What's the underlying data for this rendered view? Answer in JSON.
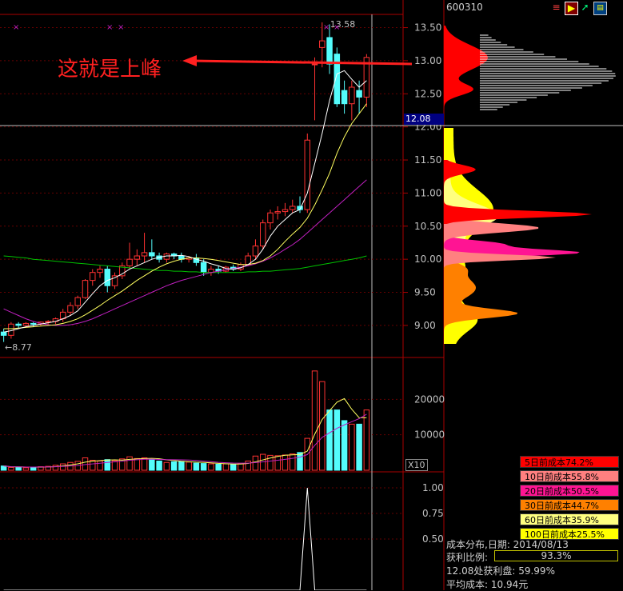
{
  "toolbar": {
    "symbol": "600310",
    "icons": [
      "bars-icon",
      "flag-icon",
      "arrow-icon",
      "window-icon"
    ]
  },
  "annotation": {
    "text": "这就是上峰"
  },
  "price_axis": {
    "labels": [
      "13.50",
      "13.00",
      "12.50",
      "12.00",
      "11.50",
      "11.00",
      "10.50",
      "10.00",
      "9.50",
      "9.00"
    ],
    "current_price": "12.08"
  },
  "candles": {
    "high_label": "13.58",
    "low_label": "8.77"
  },
  "volume_axis": {
    "labels": [
      "20000",
      "10000"
    ],
    "multiplier": "X10"
  },
  "indicator_axis": {
    "labels": [
      "1.00",
      "0.75",
      "0.50"
    ]
  },
  "chip_legend": [
    {
      "label": "5日前成本74.2%",
      "color": "#ff0000"
    },
    {
      "label": "10日前成本55.8%",
      "color": "#ff8080"
    },
    {
      "label": "20日前成本50.5%",
      "color": "#ff1493"
    },
    {
      "label": "30日前成本44.7%",
      "color": "#ff8000"
    },
    {
      "label": "60日前成本35.9%",
      "color": "#ffff80"
    },
    {
      "label": "100日前成本25.5%",
      "color": "#ffff00"
    }
  ],
  "chip_info": {
    "date_line": "成本分布,日期: 2014/08/13",
    "profit_label": "获利比例:",
    "profit_value": "93.3%",
    "profit_ratio": 0.933,
    "profit_at_price": "12.08处获利盘: 59.99%",
    "avg_cost": "平均成本: 10.94元"
  },
  "chart_data": {
    "type": "candlestick",
    "price_range": [
      8.6,
      13.7
    ],
    "candles": [
      [
        8.9,
        8.95,
        8.75,
        8.85
      ],
      [
        8.85,
        9.05,
        8.8,
        9.02
      ],
      [
        9.02,
        9.05,
        8.95,
        9.0
      ],
      [
        9.0,
        9.05,
        8.97,
        9.03
      ],
      [
        9.03,
        9.05,
        8.98,
        9.02
      ],
      [
        9.02,
        9.06,
        9.0,
        9.05
      ],
      [
        9.05,
        9.08,
        9.0,
        9.06
      ],
      [
        9.06,
        9.12,
        9.02,
        9.1
      ],
      [
        9.1,
        9.25,
        9.05,
        9.2
      ],
      [
        9.2,
        9.35,
        9.15,
        9.3
      ],
      [
        9.3,
        9.45,
        9.25,
        9.42
      ],
      [
        9.42,
        9.7,
        9.4,
        9.68
      ],
      [
        9.68,
        9.85,
        9.6,
        9.8
      ],
      [
        9.8,
        9.9,
        9.72,
        9.85
      ],
      [
        9.85,
        9.9,
        9.5,
        9.6
      ],
      [
        9.6,
        9.8,
        9.55,
        9.75
      ],
      [
        9.75,
        9.95,
        9.7,
        9.9
      ],
      [
        9.9,
        10.25,
        9.85,
        10.0
      ],
      [
        10.0,
        10.15,
        9.9,
        10.05
      ],
      [
        10.05,
        10.4,
        9.95,
        10.1
      ],
      [
        10.1,
        10.3,
        10.0,
        10.05
      ],
      [
        10.05,
        10.1,
        9.95,
        10.0
      ],
      [
        10.0,
        10.1,
        9.95,
        10.08
      ],
      [
        10.08,
        10.1,
        10.0,
        10.05
      ],
      [
        10.05,
        10.1,
        9.95,
        10.0
      ],
      [
        10.0,
        10.05,
        9.95,
        10.02
      ],
      [
        10.02,
        10.08,
        9.9,
        9.95
      ],
      [
        9.95,
        10.0,
        9.75,
        9.8
      ],
      [
        9.8,
        9.9,
        9.75,
        9.85
      ],
      [
        9.85,
        9.9,
        9.78,
        9.82
      ],
      [
        9.82,
        9.9,
        9.8,
        9.88
      ],
      [
        9.88,
        9.92,
        9.82,
        9.85
      ],
      [
        9.85,
        9.95,
        9.82,
        9.92
      ],
      [
        9.92,
        10.1,
        9.9,
        10.05
      ],
      [
        10.05,
        10.3,
        10.0,
        10.2
      ],
      [
        10.2,
        10.6,
        10.15,
        10.55
      ],
      [
        10.55,
        10.75,
        10.45,
        10.7
      ],
      [
        10.7,
        10.8,
        10.6,
        10.72
      ],
      [
        10.72,
        10.85,
        10.65,
        10.75
      ],
      [
        10.75,
        10.9,
        10.7,
        10.8
      ],
      [
        10.8,
        10.95,
        10.7,
        10.75
      ],
      [
        10.75,
        11.9,
        10.7,
        11.8
      ],
      [
        12.95,
        13.05,
        12.1,
        12.95
      ],
      [
        13.2,
        13.58,
        12.9,
        13.3
      ],
      [
        13.35,
        13.55,
        12.8,
        12.95
      ],
      [
        13.1,
        13.2,
        12.3,
        12.35
      ],
      [
        12.55,
        12.7,
        12.2,
        12.35
      ],
      [
        12.35,
        12.7,
        12.1,
        12.6
      ],
      [
        12.55,
        12.7,
        12.2,
        12.45
      ],
      [
        12.45,
        13.1,
        12.3,
        13.05
      ]
    ],
    "volumes": [
      1200,
      800,
      900,
      700,
      900,
      1000,
      1100,
      1400,
      1800,
      2200,
      2500,
      3500,
      2800,
      2600,
      3000,
      2700,
      3200,
      3800,
      3300,
      3500,
      3000,
      2600,
      2200,
      2400,
      2500,
      2300,
      2000,
      1900,
      1800,
      1700,
      1800,
      1600,
      1900,
      2600,
      4000,
      4500,
      4200,
      4100,
      4300,
      4600,
      5000,
      9000,
      28000,
      25000,
      17000,
      17000,
      14000,
      13000,
      13000,
      17000
    ],
    "volume_range": [
      0,
      30000
    ],
    "ma5": [
      8.9,
      8.92,
      8.95,
      8.98,
      9.0,
      9.02,
      9.04,
      9.06,
      9.1,
      9.15,
      9.22,
      9.35,
      9.48,
      9.6,
      9.68,
      9.72,
      9.78,
      9.85,
      9.9,
      9.95,
      10.0,
      10.03,
      10.05,
      10.05,
      10.06,
      10.04,
      10.0,
      9.97,
      9.93,
      9.9,
      9.86,
      9.85,
      9.87,
      9.92,
      10.0,
      10.15,
      10.35,
      10.5,
      10.6,
      10.7,
      10.75,
      11.0,
      11.45,
      11.9,
      12.4,
      12.8,
      12.85,
      12.72,
      12.6,
      12.7
    ],
    "ma10": [
      8.95,
      8.95,
      8.96,
      8.97,
      8.98,
      8.99,
      9.0,
      9.01,
      9.03,
      9.06,
      9.1,
      9.16,
      9.23,
      9.3,
      9.38,
      9.45,
      9.52,
      9.6,
      9.68,
      9.75,
      9.82,
      9.88,
      9.93,
      9.97,
      10.0,
      10.02,
      10.02,
      10.01,
      10.0,
      9.98,
      9.96,
      9.94,
      9.92,
      9.92,
      9.94,
      9.98,
      10.05,
      10.15,
      10.27,
      10.38,
      10.48,
      10.62,
      10.82,
      11.05,
      11.3,
      11.6,
      11.85,
      12.05,
      12.2,
      12.35
    ],
    "ma30": [
      9.25,
      9.2,
      9.15,
      9.1,
      9.06,
      9.03,
      9.01,
      9.0,
      9.0,
      9.01,
      9.03,
      9.06,
      9.1,
      9.15,
      9.2,
      9.25,
      9.3,
      9.35,
      9.4,
      9.45,
      9.5,
      9.55,
      9.6,
      9.64,
      9.68,
      9.71,
      9.74,
      9.77,
      9.8,
      9.82,
      9.84,
      9.86,
      9.88,
      9.9,
      9.93,
      9.97,
      10.02,
      10.08,
      10.15,
      10.22,
      10.3,
      10.4,
      10.5,
      10.6,
      10.7,
      10.8,
      10.9,
      11.0,
      11.1,
      11.2
    ],
    "ma60": [
      10.05,
      10.04,
      10.03,
      10.02,
      10.0,
      9.99,
      9.98,
      9.97,
      9.96,
      9.95,
      9.94,
      9.93,
      9.92,
      9.91,
      9.9,
      9.89,
      9.88,
      9.87,
      9.86,
      9.85,
      9.84,
      9.83,
      9.83,
      9.82,
      9.82,
      9.81,
      9.81,
      9.8,
      9.8,
      9.8,
      9.8,
      9.8,
      9.8,
      9.81,
      9.81,
      9.82,
      9.82,
      9.83,
      9.84,
      9.85,
      9.86,
      9.88,
      9.9,
      9.92,
      9.94,
      9.96,
      9.98,
      10.0,
      10.02,
      10.05
    ],
    "indicator": [
      0,
      0,
      0,
      0,
      0,
      0,
      0,
      0,
      0,
      0,
      0,
      0,
      0,
      0,
      0,
      0,
      0,
      0,
      0,
      0,
      0,
      0,
      0,
      0,
      0,
      0,
      0,
      0,
      0,
      0,
      0,
      0,
      0,
      0,
      0,
      0,
      0,
      0,
      0,
      0,
      0,
      1,
      0,
      0,
      0,
      0,
      0,
      0,
      0,
      0
    ]
  }
}
